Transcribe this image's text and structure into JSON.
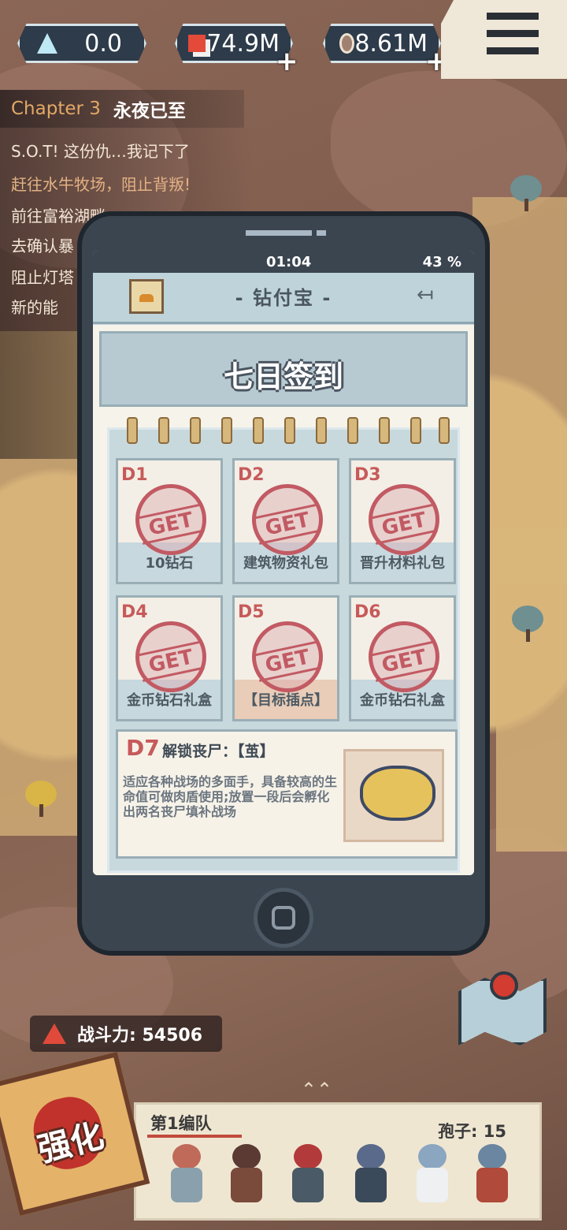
{
  "topbar": {
    "crystal": {
      "icon": "crystal-icon",
      "value": "0.0"
    },
    "materials": {
      "icon": "materials-icon",
      "value": "74.9M"
    },
    "coins": {
      "icon": "coin-icon",
      "value": "8.61M"
    },
    "plus": "+"
  },
  "quests": {
    "chapter_num": "Chapter 3",
    "chapter_title": "永夜已至",
    "items": [
      {
        "text": "S.O.T! 这份仇…我记下了"
      },
      {
        "text": "赶往水牛牧场，阻止背叛!"
      },
      {
        "text": "前往富裕湖畔"
      },
      {
        "text": "去确认暴"
      },
      {
        "text": "阻止灯塔"
      },
      {
        "text": "新的能"
      }
    ]
  },
  "phone": {
    "time": "01:04",
    "battery": "43 %",
    "app_title": "- 钻付宝 -",
    "banner_title": "七日签到",
    "days": [
      {
        "label": "D1",
        "name": "10钻石",
        "stamp": "GET"
      },
      {
        "label": "D2",
        "name": "建筑物资礼包",
        "stamp": "GET"
      },
      {
        "label": "D3",
        "name": "晋升材料礼包",
        "stamp": "GET"
      },
      {
        "label": "D4",
        "name": "金币钻石礼盒",
        "stamp": "GET"
      },
      {
        "label": "D5",
        "name": "【目标插点】",
        "stamp": "GET"
      },
      {
        "label": "D6",
        "name": "金币钻石礼盒",
        "stamp": "GET"
      }
    ],
    "day7": {
      "label": "D7",
      "header": "解锁丧尸：【茧】",
      "desc": "适应各种战场的多面手，具备较高的生命值可做肉盾使用;放置一段后会孵化出两名丧尸填补战场"
    }
  },
  "combat_power": {
    "label": "战斗力: 54506"
  },
  "squad": {
    "name": "第1编队",
    "spores": "孢子: 15"
  },
  "enhance": {
    "label": "强化"
  },
  "colors": {
    "accent_red": "#c25a63",
    "panel": "#c3d5dc",
    "frame": "#3b4550"
  }
}
